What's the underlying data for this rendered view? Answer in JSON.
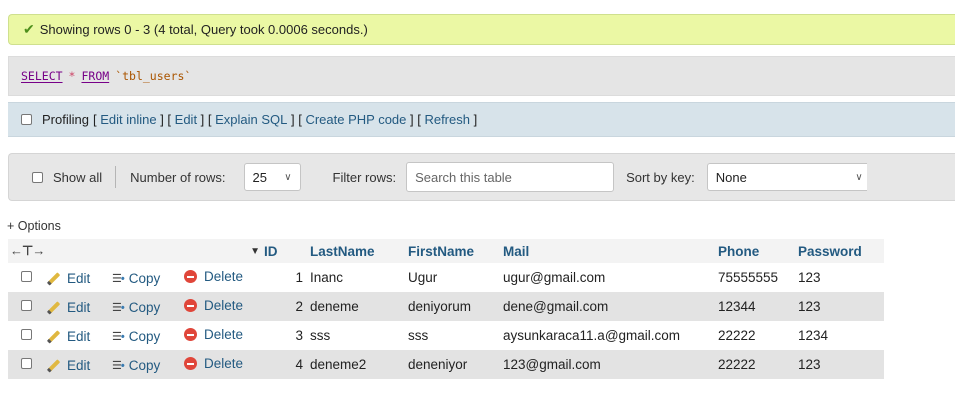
{
  "success_message": "Showing rows 0 - 3 (4 total, Query took 0.0006 seconds.)",
  "sql": {
    "keyword1": "SELECT",
    "operator": "*",
    "keyword2": "FROM",
    "table": "`tbl_users`"
  },
  "profiling": {
    "label": "Profiling",
    "links": [
      "Edit inline",
      "Edit",
      "Explain SQL",
      "Create PHP code",
      "Refresh"
    ]
  },
  "navigation": {
    "show_all": "Show all",
    "rows_label": "Number of rows:",
    "rows_value": "25",
    "filter_label": "Filter rows:",
    "filter_placeholder": "Search this table",
    "sort_label": "Sort by key:",
    "sort_value": "None"
  },
  "options_link": "+ Options",
  "row_actions": {
    "edit": "Edit",
    "copy": "Copy",
    "delete": "Delete"
  },
  "columns": [
    "ID",
    "LastName",
    "FirstName",
    "Mail",
    "Phone",
    "Password"
  ],
  "rows": [
    {
      "id": "1",
      "last": "Inanc",
      "first": "Ugur",
      "mail": "ugur@gmail.com",
      "phone": "75555555",
      "password": "123"
    },
    {
      "id": "2",
      "last": "deneme",
      "first": "deniyorum",
      "mail": "dene@gmail.com",
      "phone": "12344",
      "password": "123"
    },
    {
      "id": "3",
      "last": "sss",
      "first": "sss",
      "mail": "aysunkaraca11.a@gmail.com",
      "phone": "22222",
      "password": "1234"
    },
    {
      "id": "4",
      "last": "deneme2",
      "first": "deneniyor",
      "mail": "123@gmail.com",
      "phone": "22222",
      "password": "123"
    }
  ],
  "colors": {
    "success_bg": "#ebf8a4",
    "link": "#235a81",
    "header_bar": "#d7e3ea"
  }
}
